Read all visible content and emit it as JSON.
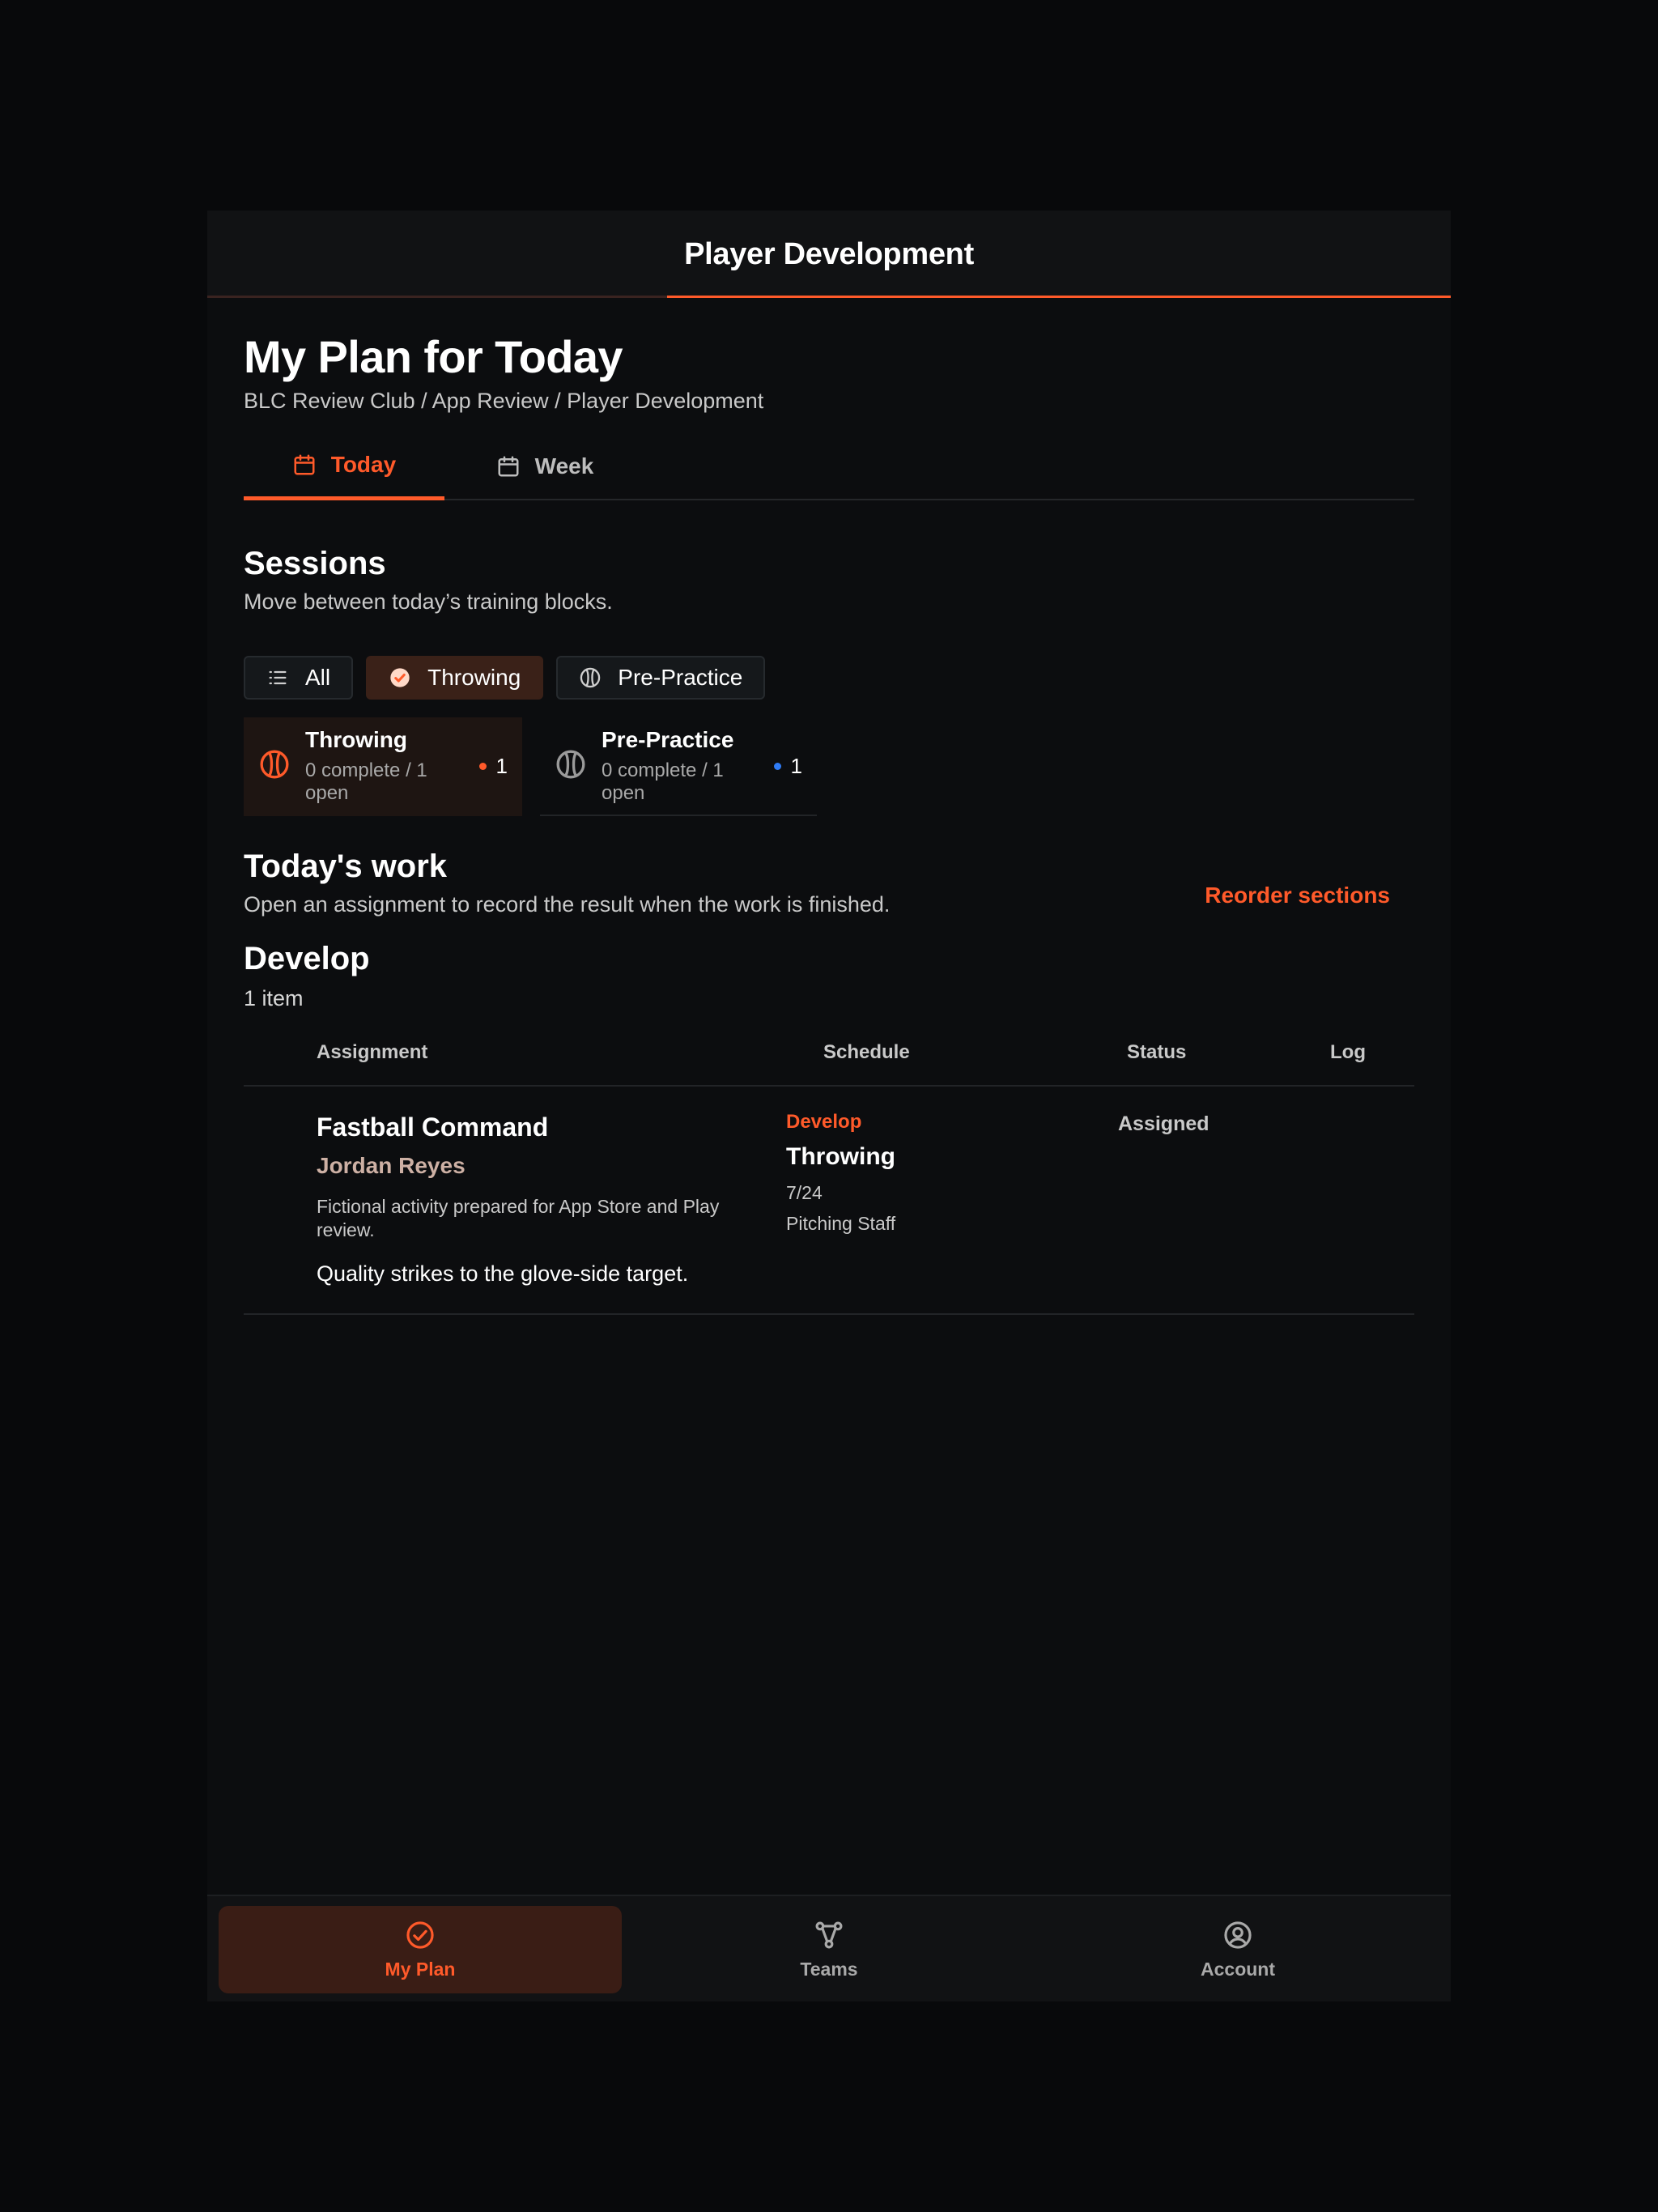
{
  "header": {
    "title": "Player Development",
    "progress": 0.63
  },
  "page": {
    "title": "My Plan for Today",
    "breadcrumb": "BLC Review Club / App Review / Player Development"
  },
  "tabs": [
    {
      "label": "Today",
      "icon": "calendar-icon",
      "active": true
    },
    {
      "label": "Week",
      "icon": "calendar-icon",
      "active": false
    }
  ],
  "sessions": {
    "title": "Sessions",
    "subtitle": "Move between today’s training blocks.",
    "filters": [
      {
        "label": "All",
        "icon": "list-icon",
        "selected": false
      },
      {
        "label": "Throwing",
        "icon": "check-circle-icon",
        "selected": true
      },
      {
        "label": "Pre-Practice",
        "icon": "baseball-icon",
        "selected": false
      }
    ],
    "cards": [
      {
        "name": "Throwing",
        "stats": "0 complete / 1 open",
        "count": "1",
        "selected": true
      },
      {
        "name": "Pre-Practice",
        "stats": "0 complete / 1 open",
        "count": "1",
        "selected": false
      }
    ]
  },
  "work": {
    "title": "Today's work",
    "subtitle": "Open an assignment to record the result when the work is finished.",
    "reorder_label": "Reorder sections"
  },
  "develop": {
    "title": "Develop",
    "count": "1 item",
    "columns": {
      "assignment": "Assignment",
      "schedule": "Schedule",
      "status": "Status",
      "log": "Log"
    },
    "rows": [
      {
        "title": "Fastball Command",
        "person": "Jordan Reyes",
        "description": "Fictional activity prepared for App Store and Play review.",
        "note": "Quality strikes to the glove-side target.",
        "schedule_tag": "Develop",
        "schedule_name": "Throwing",
        "date": "7/24",
        "staff": "Pitching Staff",
        "status": "Assigned"
      }
    ]
  },
  "nav": [
    {
      "label": "My Plan",
      "icon": "check-circle-icon",
      "active": true
    },
    {
      "label": "Teams",
      "icon": "network-icon",
      "active": false
    },
    {
      "label": "Account",
      "icon": "user-circle-icon",
      "active": false
    }
  ],
  "colors": {
    "accent": "#ff5a2a",
    "background": "#0c0d0f",
    "dot_orange": "#ff5a2a",
    "dot_blue": "#2f7bf5"
  }
}
